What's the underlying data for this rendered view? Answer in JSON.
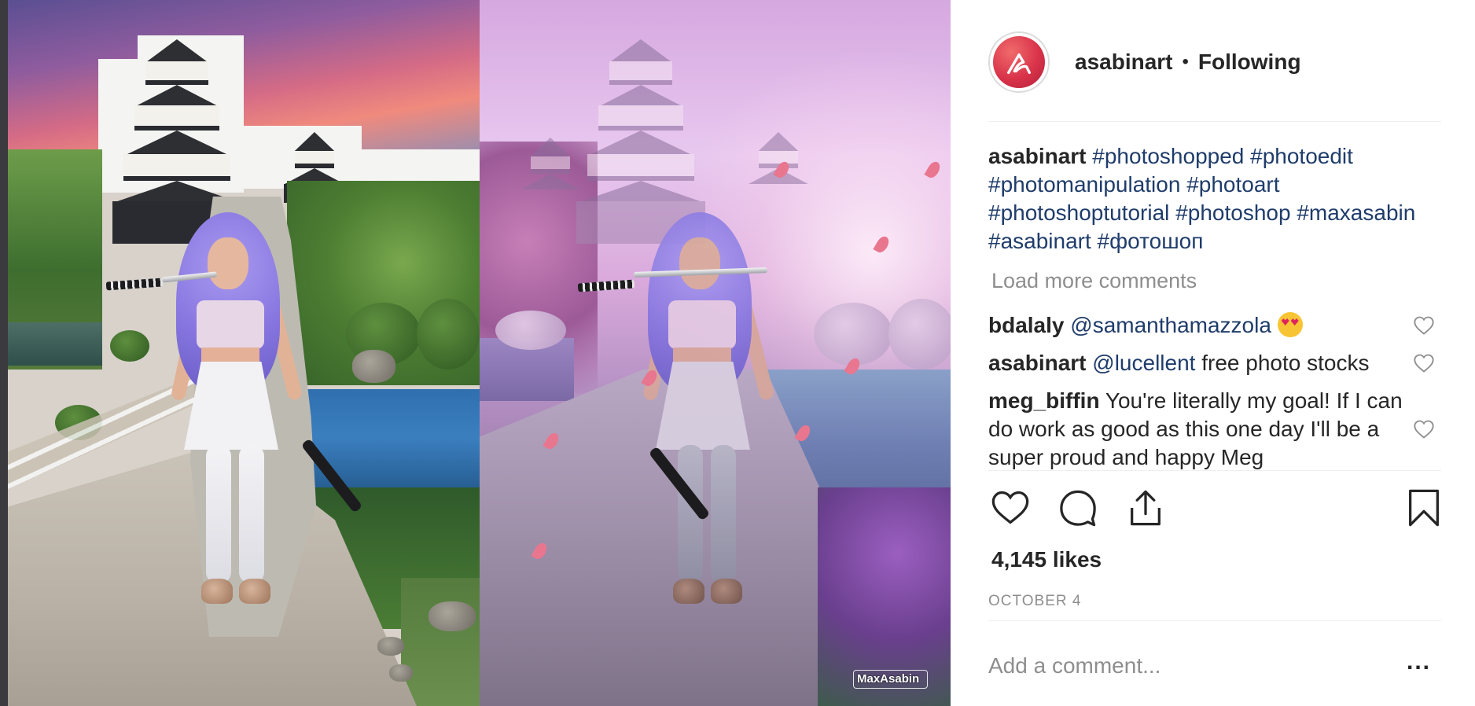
{
  "post": {
    "watermark": "MaxAsabin"
  },
  "header": {
    "username": "asabinart",
    "separator": "•",
    "following_label": "Following",
    "avatar_icon": "asabin-logo-icon"
  },
  "caption": {
    "username": "asabinart",
    "hashtags": [
      "#photoshopped",
      "#photoedit",
      "#photomanipulation",
      "#photoart",
      "#photoshoptutorial",
      "#photoshop",
      "#maxasabin",
      "#asabinart",
      "#фотошоп"
    ]
  },
  "load_more_label": "Load more comments",
  "comments": [
    {
      "username": "bdalaly",
      "mention": "@samanthamazzola",
      "text": "",
      "emoji": "heart-eyes-emoji"
    },
    {
      "username": "asabinart",
      "mention": "@lucellent",
      "text": " free photo stocks"
    },
    {
      "username": "meg_biffin",
      "mention": "",
      "text": " You're literally my goal! If I can do work as good as this one day I'll be a super proud and happy Meg"
    }
  ],
  "actions": {
    "like_icon": "heart-icon",
    "comment_icon": "speech-bubble-icon",
    "share_icon": "share-icon",
    "save_icon": "bookmark-icon"
  },
  "likes_label": "4,145 likes",
  "date_label": "OCTOBER 4",
  "add_comment": {
    "placeholder": "Add a comment...",
    "more_label": "..."
  },
  "colors": {
    "link": "#1f3c6b",
    "muted": "#8e8e8e",
    "text": "#262626",
    "avatar": "#d9334a"
  }
}
